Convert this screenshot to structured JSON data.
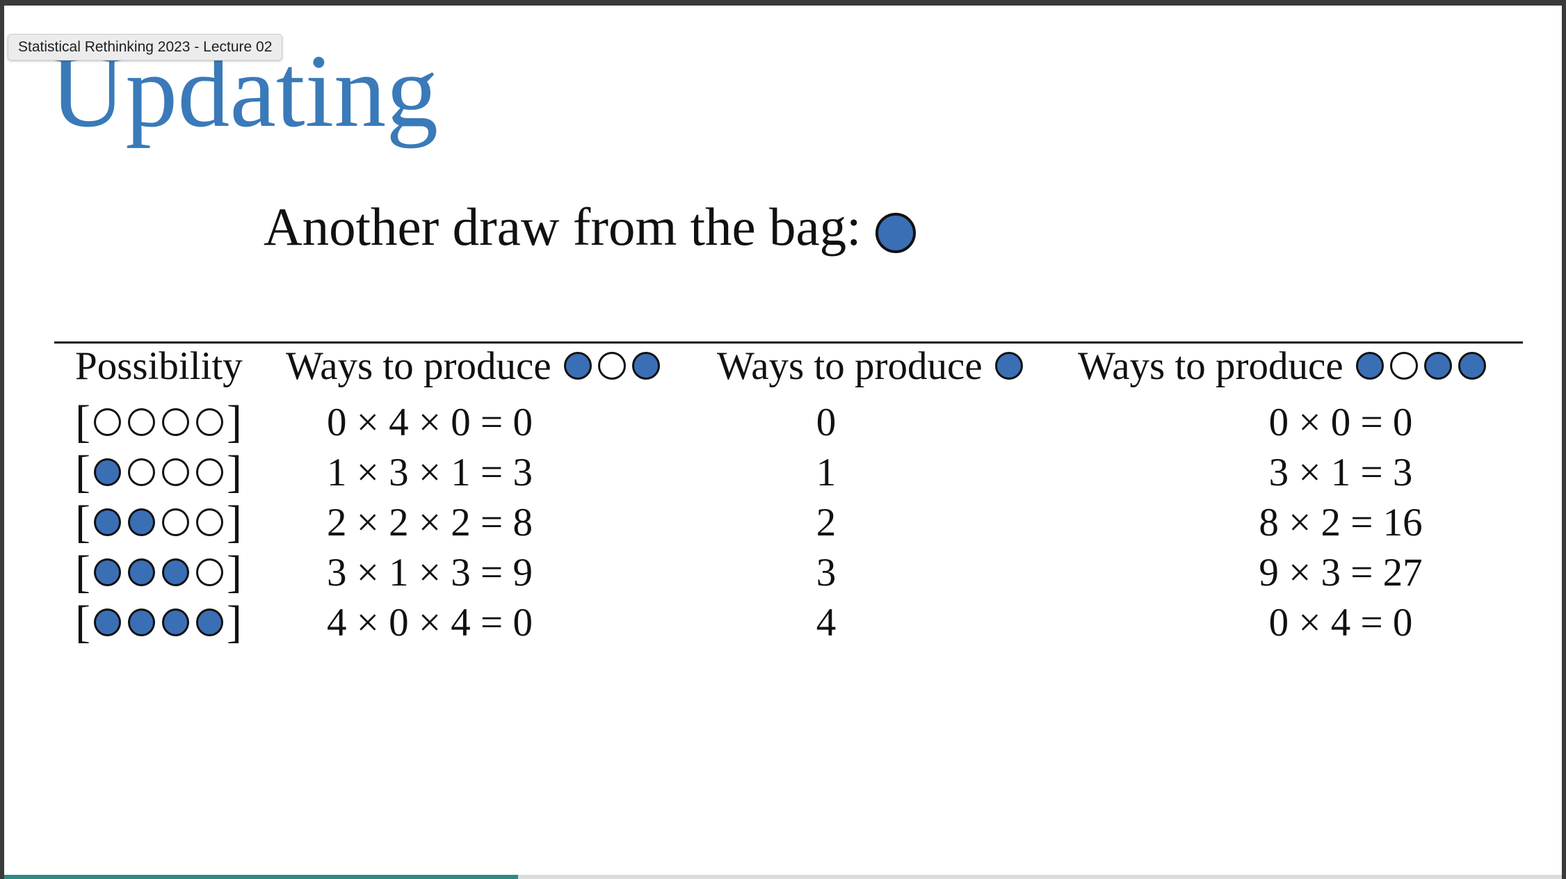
{
  "window": {
    "tooltip": "Statistical Rethinking 2023 - Lecture 02"
  },
  "slide": {
    "title": "Updating",
    "subtitle": "Another draw from the bag:",
    "subtitle_ball": "blue",
    "colors": {
      "title": "#3a7ab8",
      "marble_blue": "#3a6fb6",
      "marble_white": "#ffffff",
      "progress": "#2e8a84"
    },
    "table": {
      "headers": [
        {
          "text": "Possibility",
          "balls": []
        },
        {
          "text": "Ways to produce",
          "balls": [
            "blue",
            "white",
            "blue"
          ]
        },
        {
          "text": "Ways to produce",
          "balls": [
            "blue"
          ]
        },
        {
          "text": "Ways to produce",
          "balls": [
            "blue",
            "white",
            "blue",
            "blue"
          ]
        }
      ],
      "rows": [
        {
          "possibility": [
            "white",
            "white",
            "white",
            "white"
          ],
          "prior": "0 × 4 × 0 = 0",
          "new": "0",
          "updated": "0 × 0 = 0"
        },
        {
          "possibility": [
            "blue",
            "white",
            "white",
            "white"
          ],
          "prior": "1 × 3 × 1 = 3",
          "new": "1",
          "updated": "3 × 1 = 3"
        },
        {
          "possibility": [
            "blue",
            "blue",
            "white",
            "white"
          ],
          "prior": "2 × 2 × 2 = 8",
          "new": "2",
          "updated": "8 × 2 = 16"
        },
        {
          "possibility": [
            "blue",
            "blue",
            "blue",
            "white"
          ],
          "prior": "3 × 1 × 3 = 9",
          "new": "3",
          "updated": "9 × 3 = 27"
        },
        {
          "possibility": [
            "blue",
            "blue",
            "blue",
            "blue"
          ],
          "prior": "4 × 0 × 4 = 0",
          "new": "4",
          "updated": "0 × 4 = 0"
        }
      ]
    }
  },
  "playback": {
    "progress_fraction": 0.33
  }
}
